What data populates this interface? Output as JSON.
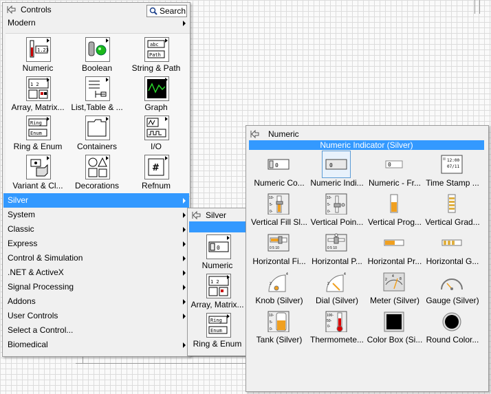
{
  "controls": {
    "title": "Controls",
    "search_label": "Search",
    "category": "Modern",
    "items": [
      {
        "label": "Numeric",
        "icon": "numeric-palette-icon"
      },
      {
        "label": "Boolean",
        "icon": "boolean-palette-icon"
      },
      {
        "label": "String & Path",
        "icon": "string-path-palette-icon"
      },
      {
        "label": "Array, Matrix...",
        "icon": "array-matrix-palette-icon"
      },
      {
        "label": "List,Table & ...",
        "icon": "list-table-palette-icon"
      },
      {
        "label": "Graph",
        "icon": "graph-palette-icon"
      },
      {
        "label": "Ring & Enum",
        "icon": "ring-enum-palette-icon"
      },
      {
        "label": "Containers",
        "icon": "containers-palette-icon"
      },
      {
        "label": "I/O",
        "icon": "io-palette-icon"
      },
      {
        "label": "Variant & Cl...",
        "icon": "variant-class-palette-icon"
      },
      {
        "label": "Decorations",
        "icon": "decorations-palette-icon"
      },
      {
        "label": "Refnum",
        "icon": "refnum-palette-icon"
      }
    ],
    "menu": [
      {
        "label": "Silver",
        "highlighted": true
      },
      {
        "label": "System"
      },
      {
        "label": "Classic"
      },
      {
        "label": "Express"
      },
      {
        "label": "Control & Simulation"
      },
      {
        "label": ".NET & ActiveX"
      },
      {
        "label": "Signal Processing"
      },
      {
        "label": "Addons"
      },
      {
        "label": "User Controls"
      },
      {
        "label": "Select a Control..."
      },
      {
        "label": "Biomedical"
      }
    ]
  },
  "silver": {
    "title": "Silver",
    "items": [
      {
        "label": "Numeric"
      },
      {
        "label": "Array, Matrix..."
      },
      {
        "label": "Ring & Enum"
      }
    ]
  },
  "numeric": {
    "title": "Numeric",
    "selected_label": "Numeric Indicator (Silver)",
    "items": [
      {
        "label": "Numeric Co...",
        "icon": "numeric-control-icon"
      },
      {
        "label": "Numeric Indi...",
        "icon": "numeric-indicator-icon",
        "selected": true
      },
      {
        "label": "Numeric - Fr...",
        "icon": "numeric-frameless-icon"
      },
      {
        "label": "Time Stamp ...",
        "icon": "time-stamp-icon"
      },
      {
        "label": "Vertical Fill Sl...",
        "icon": "vertical-fill-slide-icon"
      },
      {
        "label": "Vertical Poin...",
        "icon": "vertical-pointer-slide-icon"
      },
      {
        "label": "Vertical Prog...",
        "icon": "vertical-progress-bar-icon"
      },
      {
        "label": "Vertical Grad...",
        "icon": "vertical-graduated-bar-icon"
      },
      {
        "label": "Horizontal Fi...",
        "icon": "horizontal-fill-slide-icon"
      },
      {
        "label": "Horizontal P...",
        "icon": "horizontal-pointer-slide-icon"
      },
      {
        "label": "Horizontal Pr...",
        "icon": "horizontal-progress-bar-icon"
      },
      {
        "label": "Horizontal G...",
        "icon": "horizontal-graduated-bar-icon"
      },
      {
        "label": "Knob (Silver)",
        "icon": "knob-icon"
      },
      {
        "label": "Dial (Silver)",
        "icon": "dial-icon"
      },
      {
        "label": "Meter (Silver)",
        "icon": "meter-icon"
      },
      {
        "label": "Gauge (Silver)",
        "icon": "gauge-icon"
      },
      {
        "label": "Tank (Silver)",
        "icon": "tank-icon"
      },
      {
        "label": "Thermomete...",
        "icon": "thermometer-icon"
      },
      {
        "label": "Color Box (Si...",
        "icon": "color-box-icon"
      },
      {
        "label": "Round Color...",
        "icon": "round-color-box-icon"
      }
    ]
  },
  "colors": {
    "highlight": "#3399ff",
    "panel": "#f0f0f0"
  }
}
